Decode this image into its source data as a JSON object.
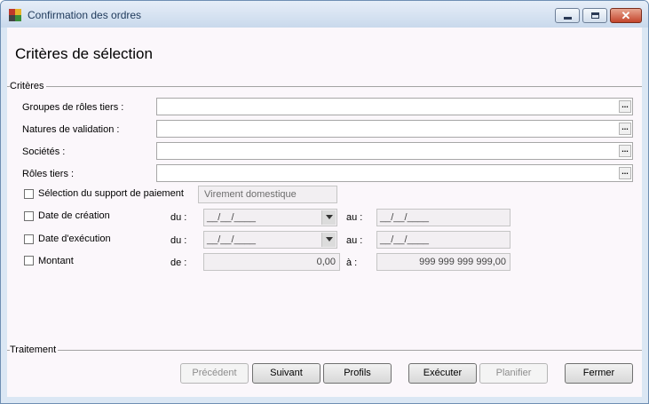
{
  "window": {
    "title": "Confirmation des ordres",
    "close_glyph": "✕"
  },
  "colors": {
    "title_text": "#1e395b",
    "content_bg": "#fbf7fb",
    "close_button": "#c4452c"
  },
  "page": {
    "heading": "Critères de sélection"
  },
  "criteria": {
    "section_label": "Critères",
    "rows": [
      {
        "label": "Groupes de rôles tiers :",
        "value": ""
      },
      {
        "label": "Natures de validation :",
        "value": ""
      },
      {
        "label": "Sociétés :",
        "value": ""
      },
      {
        "label": "Rôles tiers :",
        "value": ""
      }
    ],
    "ellipsis": "...",
    "payment": {
      "label": "Sélection du support de paiement",
      "value": "Virement domestique"
    },
    "creation": {
      "label": "Date de création",
      "from_label": "du :",
      "from_value": "__/__/____",
      "to_label": "au :",
      "to_value": "__/__/____"
    },
    "execution": {
      "label": "Date d'exécution",
      "from_label": "du :",
      "from_value": "__/__/____",
      "to_label": "au :",
      "to_value": "__/__/____"
    },
    "amount": {
      "label": "Montant",
      "from_label": "de :",
      "from_value": "0,00",
      "to_label": "à :",
      "to_value": "999 999 999 999,00"
    }
  },
  "treatment": {
    "section_label": "Traitement",
    "buttons": {
      "previous": {
        "label": "Précédent",
        "enabled": false
      },
      "next": {
        "label": "Suivant",
        "enabled": true
      },
      "profiles": {
        "label": "Profils",
        "enabled": true
      },
      "execute": {
        "label": "Exécuter",
        "enabled": true
      },
      "schedule": {
        "label": "Planifier",
        "enabled": false
      },
      "close": {
        "label": "Fermer",
        "enabled": true
      }
    }
  }
}
